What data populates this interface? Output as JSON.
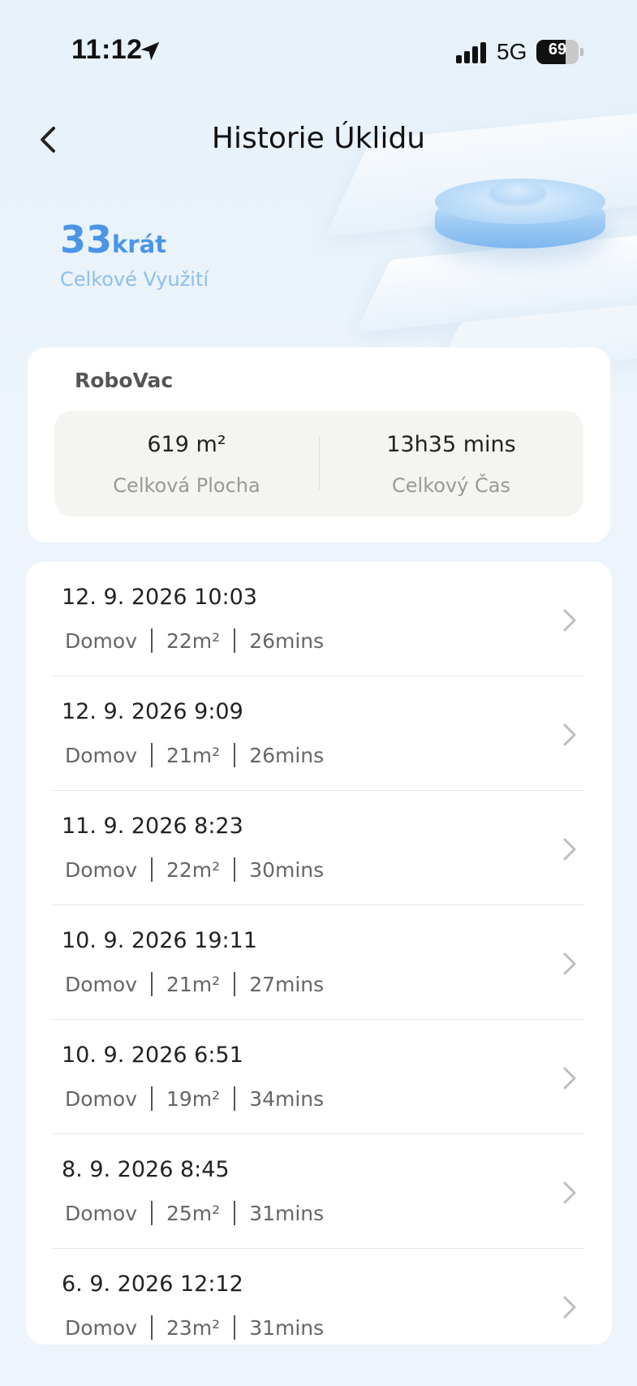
{
  "status_bar": {
    "time": "11:12",
    "network": "5G",
    "battery_level": "69",
    "battery_fraction": 0.69
  },
  "header": {
    "title": "Historie Úklidu",
    "back_icon": "chevron-left-icon"
  },
  "usage": {
    "count": "33",
    "unit": "krát",
    "label": "Celkové Využití"
  },
  "device": {
    "name": "RoboVac",
    "stats": [
      {
        "value": "619 m²",
        "label": "Celková Plocha"
      },
      {
        "value": "13h35 mins",
        "label": "Celkový Čas"
      }
    ]
  },
  "history": [
    {
      "date": "12. 9. 2026 10:03",
      "place": "Domov",
      "area": "22m²",
      "duration": "26mins"
    },
    {
      "date": "12. 9. 2026 9:09",
      "place": "Domov",
      "area": "21m²",
      "duration": "26mins"
    },
    {
      "date": "11. 9. 2026 8:23",
      "place": "Domov",
      "area": "22m²",
      "duration": "30mins"
    },
    {
      "date": "10. 9. 2026 19:11",
      "place": "Domov",
      "area": "21m²",
      "duration": "27mins"
    },
    {
      "date": "10. 9. 2026 6:51",
      "place": "Domov",
      "area": "19m²",
      "duration": "34mins"
    },
    {
      "date": "8. 9. 2026 8:45",
      "place": "Domov",
      "area": "25m²",
      "duration": "31mins"
    },
    {
      "date": "6. 9. 2026 12:12",
      "place": "Domov",
      "area": "23m²",
      "duration": "31mins"
    }
  ],
  "colors": {
    "accent": "#4a95e6",
    "accent_light": "#8cc0ee",
    "background": "#edf4fb"
  }
}
